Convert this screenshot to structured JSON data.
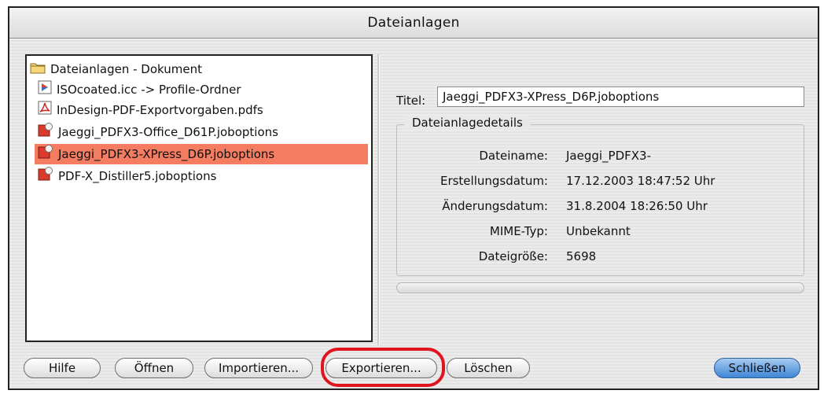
{
  "window": {
    "title": "Dateianlagen"
  },
  "tree": {
    "root": {
      "label": "Dateianlagen - Dokument",
      "icon": "folder-icon"
    },
    "items": [
      {
        "label": "ISOcoated.icc -> Profile-Ordner",
        "icon": "icc-profile-icon",
        "selected": false
      },
      {
        "label": "InDesign-PDF-Exportvorgaben.pdfs",
        "icon": "pdf-icon",
        "selected": false
      },
      {
        "label": "Jaeggi_PDFX3-Office_D61P.joboptions",
        "icon": "joboptions-icon",
        "selected": false
      },
      {
        "label": "Jaeggi_PDFX3-XPress_D6P.joboptions",
        "icon": "joboptions-icon",
        "selected": true
      },
      {
        "label": "PDF-X_Distiller5.joboptions",
        "icon": "joboptions-icon",
        "selected": false
      }
    ]
  },
  "details": {
    "title_label": "Titel:",
    "title_value": "Jaeggi_PDFX3-XPress_D6P.joboptions",
    "group_label": "Dateianlagedetails",
    "fields": [
      {
        "label": "Dateiname:",
        "value": "Jaeggi_PDFX3-"
      },
      {
        "label": "Erstellungsdatum:",
        "value": "17.12.2003 18:47:52 Uhr"
      },
      {
        "label": "Änderungsdatum:",
        "value": "31.8.2004 18:26:50 Uhr"
      },
      {
        "label": "MIME-Typ:",
        "value": "Unbekannt"
      },
      {
        "label": "Dateigröße:",
        "value": "5698"
      }
    ]
  },
  "buttons": {
    "help": "Hilfe",
    "open": "Öffnen",
    "import": "Importieren...",
    "export": "Exportieren...",
    "delete": "Löschen",
    "close": "Schließen"
  },
  "colors": {
    "selection": "#f47c61",
    "highlight_ring": "#e0141e",
    "default_button": "#3f86d6"
  }
}
